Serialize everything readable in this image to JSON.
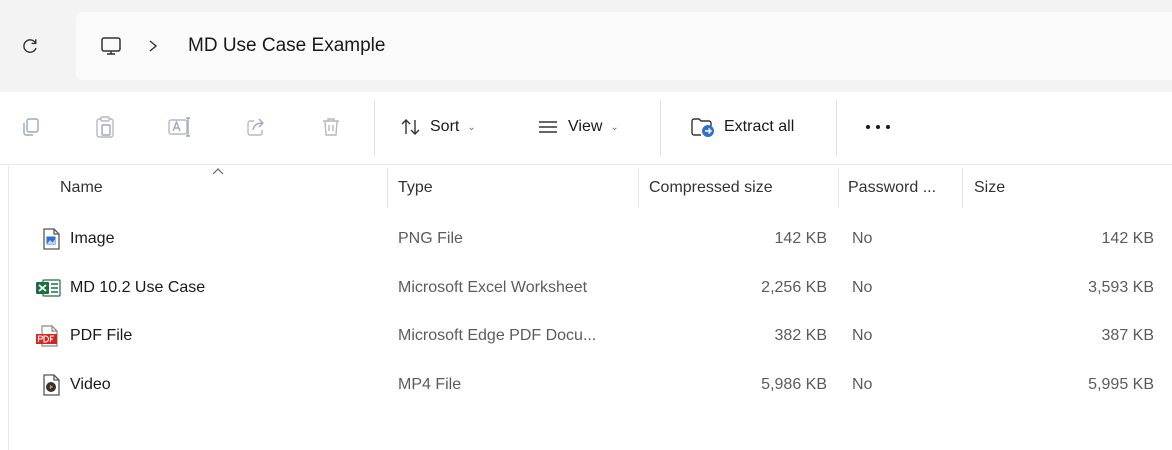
{
  "address": {
    "breadcrumb": "MD Use Case Example"
  },
  "toolbar": {
    "sort_label": "Sort",
    "view_label": "View",
    "extract_label": "Extract all"
  },
  "columns": {
    "name": "Name",
    "type": "Type",
    "compressed": "Compressed size",
    "password": "Password ...",
    "size": "Size"
  },
  "files": [
    {
      "name": "Image",
      "type": "PNG File",
      "compressed": "142 KB",
      "password": "No",
      "size": "142 KB",
      "icon": "png-file-icon"
    },
    {
      "name": "MD 10.2 Use Case",
      "type": "Microsoft Excel Worksheet",
      "compressed": "2,256 KB",
      "password": "No",
      "size": "3,593 KB",
      "icon": "excel-file-icon"
    },
    {
      "name": "PDF File",
      "type": "Microsoft Edge PDF Docu...",
      "compressed": "382 KB",
      "password": "No",
      "size": "387 KB",
      "icon": "pdf-file-icon"
    },
    {
      "name": "Video",
      "type": "MP4 File",
      "compressed": "5,986 KB",
      "password": "No",
      "size": "5,995 KB",
      "icon": "mp4-file-icon"
    }
  ],
  "colors": {
    "excel_green": "#1d6f42",
    "pdf_red": "#d9261c",
    "accent_blue": "#2f6fd0"
  }
}
